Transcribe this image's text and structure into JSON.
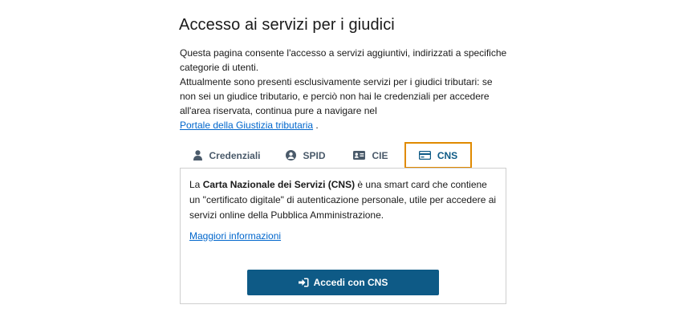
{
  "page": {
    "title": "Accesso ai servizi per i giudici",
    "intro_p1": "Questa pagina consente l'accesso a servizi aggiuntivi, indirizzati a specifiche categorie di utenti.",
    "intro_p2": "Attualmente sono presenti esclusivamente servizi per i giudici tributari: se non sei un giudice tributario, e perciò non hai le credenziali per accedere all'area riservata, continua pure a navigare nel",
    "portal_link": "Portale della Giustizia tributaria",
    "intro_end": " ."
  },
  "tabs": [
    {
      "label": "Credenziali",
      "icon": "user-icon"
    },
    {
      "label": "SPID",
      "icon": "spid-user-circle-icon"
    },
    {
      "label": "CIE",
      "icon": "id-card-icon"
    },
    {
      "label": "CNS",
      "icon": "credit-card-icon",
      "active": true
    }
  ],
  "cns_panel": {
    "desc_before": "La ",
    "desc_bold": "Carta Nazionale dei Servizi (CNS)",
    "desc_after": " è una smart card che contiene un \"certificato digitale\" di autenticazione personale, utile per accedere ai servizi online della Pubblica Amministrazione.",
    "more_link": "Maggiori informazioni",
    "button_label": "Accedi con CNS",
    "button_icon": "sign-in-icon"
  },
  "colors": {
    "primary": "#0e5a86",
    "link": "#0066cc",
    "active_tab_border": "#e08a00",
    "tab_text": "#4a5a6a"
  }
}
